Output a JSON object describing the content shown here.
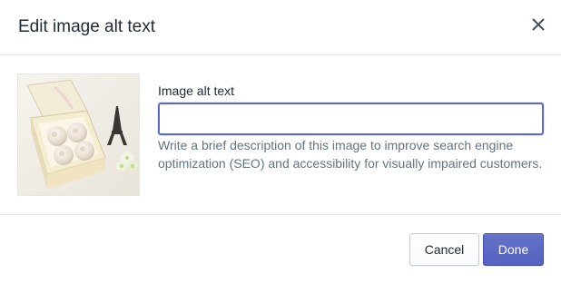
{
  "modal": {
    "title": "Edit image alt text",
    "close_icon": "close-icon"
  },
  "image": {
    "icon": "product-image"
  },
  "form": {
    "label": "Image alt text",
    "value": "",
    "placeholder": "",
    "help_text": "Write a brief description of this image to improve search engine optimization (SEO) and accessibility for visually impaired customers."
  },
  "footer": {
    "cancel_label": "Cancel",
    "done_label": "Done"
  },
  "colors": {
    "primary": "#5c6ac4",
    "border": "#dfe3e8",
    "help_text": "#637381"
  }
}
